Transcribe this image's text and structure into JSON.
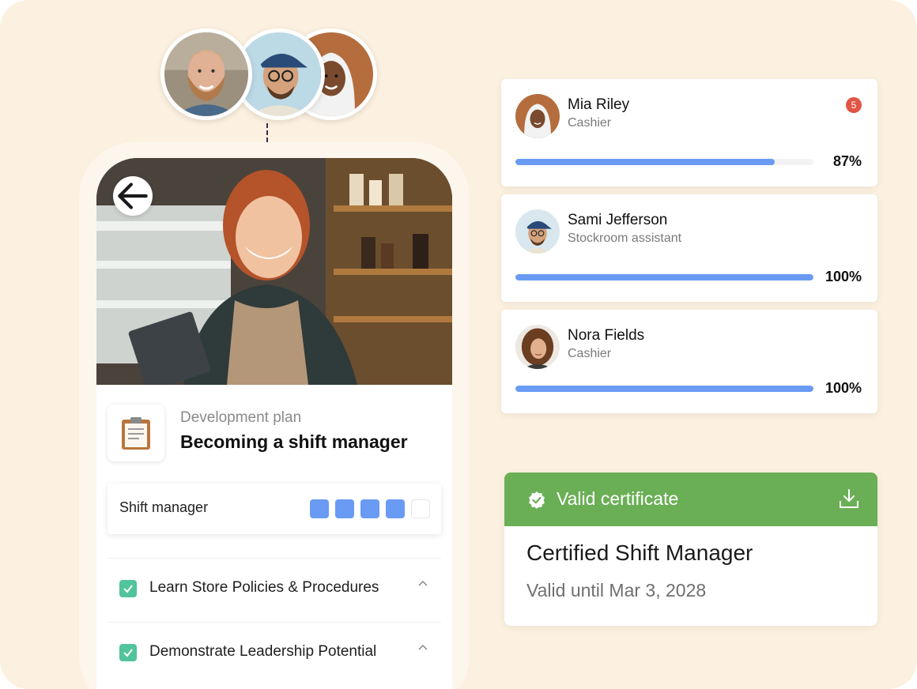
{
  "team_avatars": [
    "bearded-man-avatar",
    "man-with-cap-avatar",
    "woman-with-hijab-avatar"
  ],
  "plan": {
    "subtitle": "Development plan",
    "title": "Becoming a shift manager",
    "icon": "clipboard-icon"
  },
  "skill": {
    "label": "Shift manager",
    "level": 4,
    "max_level": 5
  },
  "tasks": [
    {
      "label": "Learn Store Policies & Procedures",
      "done": true
    },
    {
      "label": "Demonstrate Leadership Potential",
      "done": true
    }
  ],
  "employees": [
    {
      "name": "Mia Riley",
      "role": "Cashier",
      "progress": 87,
      "progress_label": "87%",
      "badge": "5"
    },
    {
      "name": "Sami Jefferson",
      "role": "Stockroom assistant",
      "progress": 100,
      "progress_label": "100%"
    },
    {
      "name": "Nora Fields",
      "role": "Cashier",
      "progress": 100,
      "progress_label": "100%"
    }
  ],
  "certificate": {
    "status": "Valid certificate",
    "title": "Certified Shift Manager",
    "valid_until": "Valid until Mar 3, 2028"
  },
  "colors": {
    "background": "#fcf1e0",
    "progress": "#6a9bf4",
    "certificate_green": "#6aaf55",
    "check_green": "#52c49b",
    "badge_red": "#e05545"
  }
}
